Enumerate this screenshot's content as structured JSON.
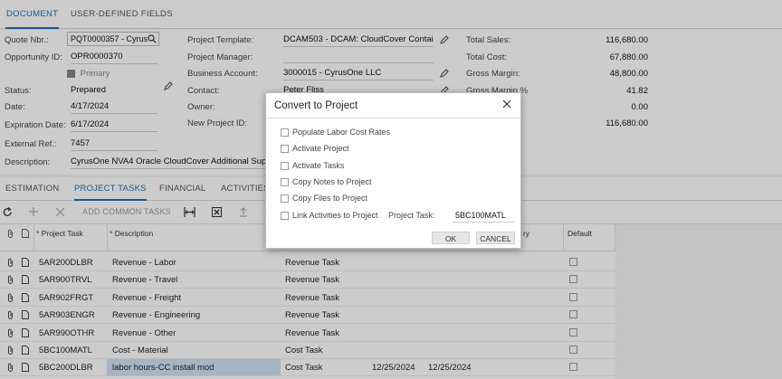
{
  "tabs": {
    "top": [
      "DOCUMENT",
      "USER-DEFINED FIELDS"
    ],
    "sub": [
      "ESTIMATION",
      "PROJECT TASKS",
      "FINANCIAL",
      "ACTIVITIES"
    ]
  },
  "form": {
    "quote_nbr_label": "Quote Nbr.:",
    "quote_nbr": "PQT0000357 - Cyrus",
    "opportunity_label": "Opportunity ID:",
    "opportunity": "OPR0000370",
    "primary_label": "Primary",
    "status_label": "Status:",
    "status": "Prepared",
    "date_label": "Date:",
    "date": "4/17/2024",
    "expiration_label": "Expiration Date:",
    "expiration": "6/17/2024",
    "external_ref_label": "External Ref.:",
    "external_ref": "7457",
    "description_label": "Description:",
    "description": "CyrusOne NVA4 Oracle CloudCover Additional Suppor",
    "project_template_label": "Project Template:",
    "project_template": "DCAM503 - DCAM: CloudCover Containr",
    "project_manager_label": "Project Manager:",
    "project_manager": "",
    "business_account_label": "Business Account:",
    "business_account": "3000015 - CyrusOne LLC",
    "contact_label": "Contact:",
    "contact": "Peter Fliss",
    "owner_label": "Owner:",
    "new_project_label": "New Project ID:",
    "total_sales_label": "Total Sales:",
    "total_sales": "116,680.00",
    "total_cost_label": "Total Cost:",
    "total_cost": "67,880.00",
    "gross_margin_label": "Gross Margin:",
    "gross_margin": "48,800.00",
    "gross_margin_pct_label": "Gross Margin %",
    "gross_margin_pct": "41.82",
    "row5_value": "0.00",
    "row6_value": "116,680.00"
  },
  "toolbar": {
    "add_common_tasks": "ADD COMMON TASKS"
  },
  "grid": {
    "headers": {
      "project_task": "Project Task",
      "description": "Description",
      "default": "Default",
      "partial": "ry"
    },
    "rows": [
      {
        "task": "5AR200DLBR",
        "description": "Revenue - Labor",
        "type": "Revenue Task",
        "start": "",
        "end": ""
      },
      {
        "task": "5AR900TRVL",
        "description": "Revenue - Travel",
        "type": "Revenue Task",
        "start": "",
        "end": ""
      },
      {
        "task": "5AR902FRGT",
        "description": "Revenue - Freight",
        "type": "Revenue Task",
        "start": "",
        "end": ""
      },
      {
        "task": "5AR903ENGR",
        "description": "Revenue - Engineering",
        "type": "Revenue Task",
        "start": "",
        "end": ""
      },
      {
        "task": "5AR990OTHR",
        "description": "Revenue - Other",
        "type": "Revenue Task",
        "start": "",
        "end": ""
      },
      {
        "task": "5BC100MATL",
        "description": "Cost - Material",
        "type": "Cost Task",
        "start": "",
        "end": ""
      },
      {
        "task": "5BC200DLBR",
        "description": "labor hours-CC install mod",
        "type": "Cost Task",
        "start": "12/25/2024",
        "end": "12/25/2024"
      }
    ]
  },
  "dialog": {
    "title": "Convert to Project",
    "options": [
      "Populate Labor Cost Rates",
      "Activate Project",
      "Activate Tasks",
      "Copy Notes to Project",
      "Copy Files to Project",
      "Link Activities to Project"
    ],
    "project_task_label": "Project Task:",
    "project_task_value": "5BC100MATL",
    "ok_label": "OK",
    "cancel_label": "CANCEL"
  }
}
